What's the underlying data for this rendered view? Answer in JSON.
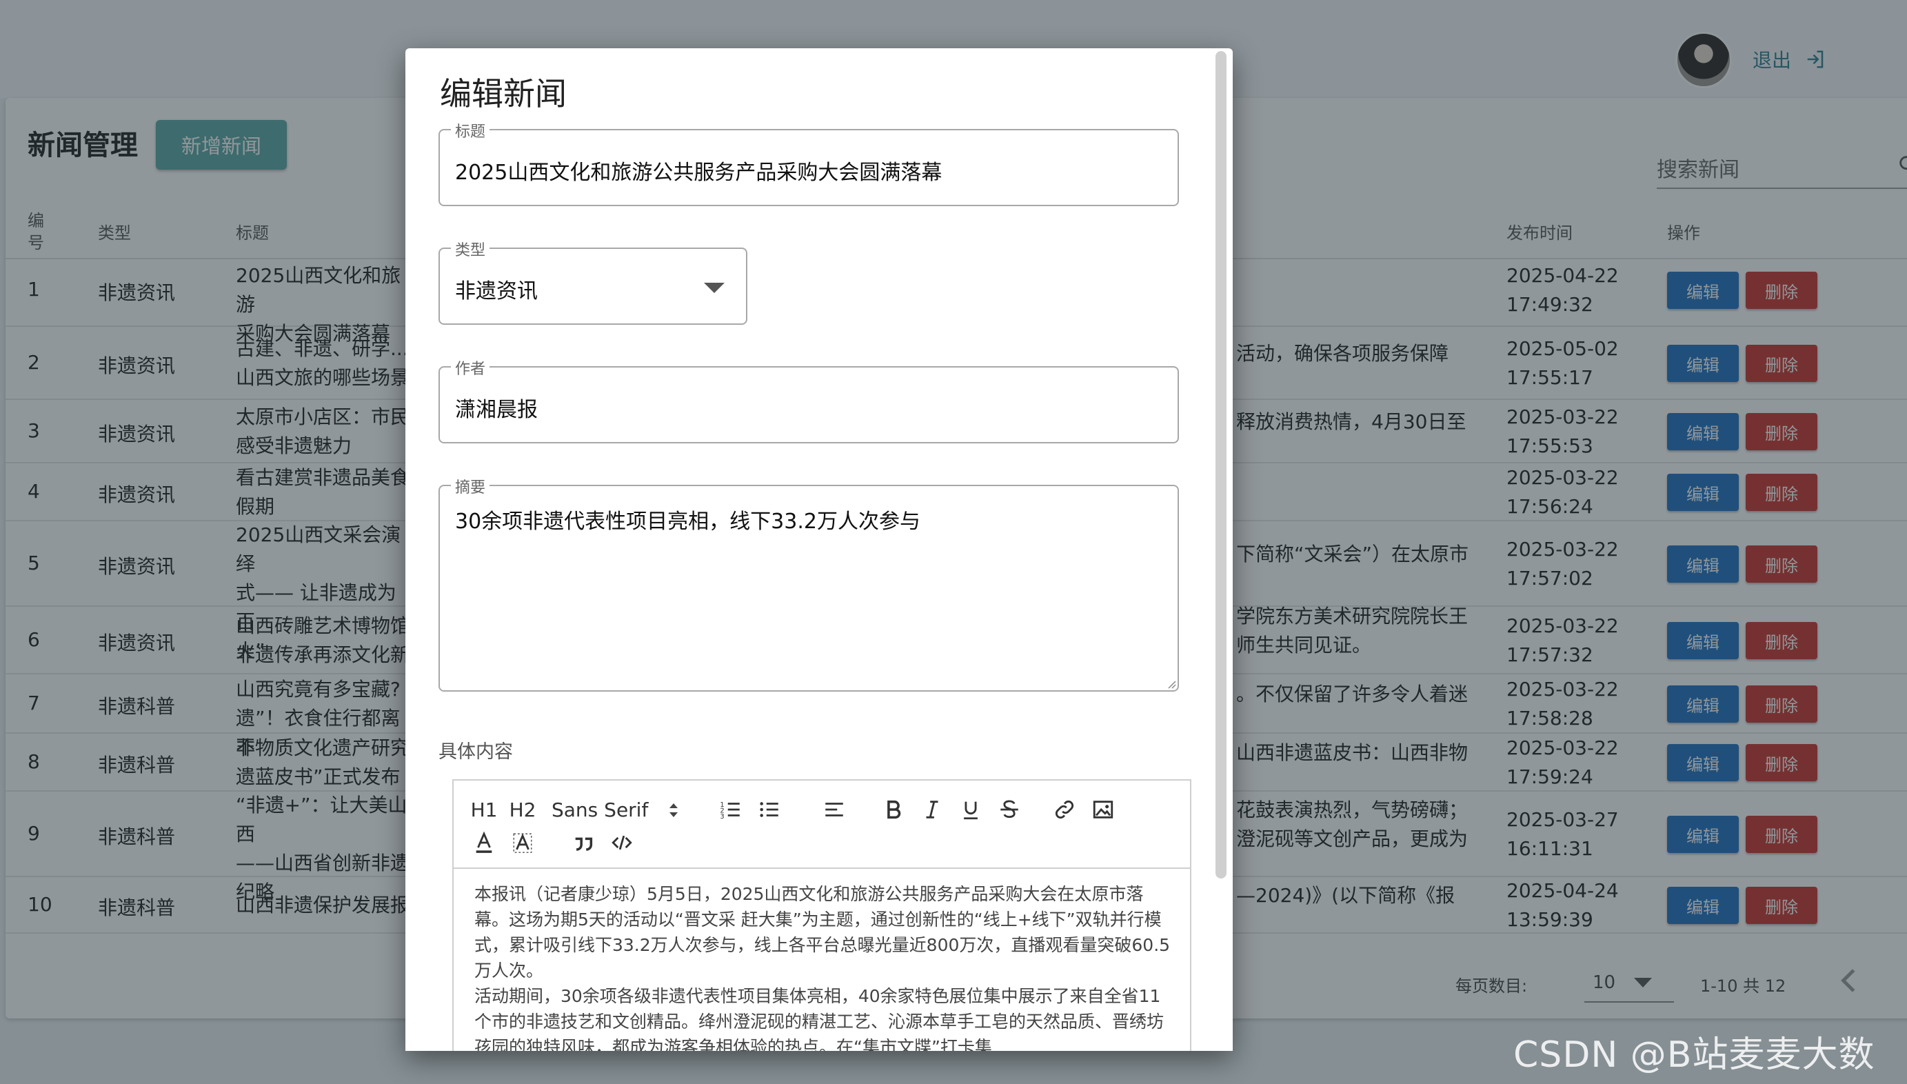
{
  "header": {
    "logout_label": "退出"
  },
  "page": {
    "title": "新闻管理",
    "add_button": "新增新闻",
    "search_placeholder": "搜索新闻"
  },
  "table": {
    "headers": {
      "num": "编\n号",
      "type": "类型",
      "title": "标题",
      "date": "发布时间",
      "ops": "操作"
    },
    "edit_label": "编辑",
    "delete_label": "删除",
    "rows": [
      {
        "num": "1",
        "type": "非遗资讯",
        "title": "2025山西文化和旅游\n采购大会圆满落幕",
        "summary": "",
        "date": "2025-04-22\n17:49:32"
      },
      {
        "num": "2",
        "type": "非遗资讯",
        "title": "古建、非遗、研学...\n山西文旅的哪些场景",
        "summary": "活动，确保各项服务保障",
        "date": "2025-05-02\n17:55:17"
      },
      {
        "num": "3",
        "type": "非遗资讯",
        "title": "太原市小店区：市民\n感受非遗魅力",
        "summary": "释放消费热情，4月30日至",
        "date": "2025-03-22\n17:55:53"
      },
      {
        "num": "4",
        "type": "非遗资讯",
        "title": "看古建赏非遗品美食\n假期",
        "summary": "",
        "date": "2025-03-22\n17:56:24"
      },
      {
        "num": "5",
        "type": "非遗资讯",
        "title": "2025山西文采会演绎\n式—— 让非遗成为百\n火”",
        "summary": "下简称“文采会”）在太原市",
        "date": "2025-03-22\n17:57:02"
      },
      {
        "num": "6",
        "type": "非遗资讯",
        "title": "山西砖雕艺术博物馆\n非遗传承再添文化新",
        "summary": "学院东方美术研究院院长王\n师生共同见证。",
        "date": "2025-03-22\n17:57:32"
      },
      {
        "num": "7",
        "type": "非遗科普",
        "title": "山西究竟有多宝藏?\n遗”！衣食住行都离不",
        "summary": "。不仅保留了许多令人着迷",
        "date": "2025-03-22\n17:58:28"
      },
      {
        "num": "8",
        "type": "非遗科普",
        "title": "非物质文化遗产研究\n遗蓝皮书”正式发布",
        "summary": "山西非遗蓝皮书：山西非物",
        "date": "2025-03-22\n17:59:24"
      },
      {
        "num": "9",
        "type": "非遗科普",
        "title": "“非遗+”：让大美山西\n——山西省创新非遗\n纪略",
        "summary": "花鼓表演热烈，气势磅礴；\n澄泥砚等文创产品，更成为",
        "date": "2025-03-27\n16:11:31"
      },
      {
        "num": "10",
        "type": "非遗科普",
        "title": "山西非遗保护发展报",
        "summary": "—2024)》(以下简称《报",
        "date": "2025-04-24\n13:59:39"
      }
    ]
  },
  "pagination": {
    "per_page_label": "每页数目:",
    "per_page_value": "10",
    "range": "1-10 共 12"
  },
  "dialog": {
    "title": "编辑新闻",
    "fields": {
      "title_label": "标题",
      "title_value": "2025山西文化和旅游公共服务产品采购大会圆满落幕",
      "type_label": "类型",
      "type_value": "非遗资讯",
      "author_label": "作者",
      "author_value": "潇湘晨报",
      "summary_label": "摘要",
      "summary_value": "30余项非遗代表性项目亮相，线下33.2万人次参与"
    },
    "content_label": "具体内容",
    "toolbar": {
      "h1": "H1",
      "h2": "H2",
      "font": "Sans Serif"
    },
    "content_paragraphs": [
      "本报讯（记者康少琼）5月5日，2025山西文化和旅游公共服务产品采购大会在太原市落幕。这场为期5天的活动以“晋文采 赶大集”为主题，通过创新性的“线上+线下”双轨并行模式，累计吸引线下33.2万人次参与，线上各平台总曝光量近800万次，直播观看量突破60.5万人次。",
      "活动期间，30余项各级非遗代表性项目集体亮相，40余家特色展位集中展示了来自全省11个市的非遗技艺和文创精品。绛州澄泥砚的精湛工艺、沁源本草手工皂的天然品质、晋绣坊孩园的独特风味，都成为游客争相体验的热点。在“集市文牒”打卡集"
    ]
  },
  "watermark": "CSDN @B站麦麦大数据"
}
